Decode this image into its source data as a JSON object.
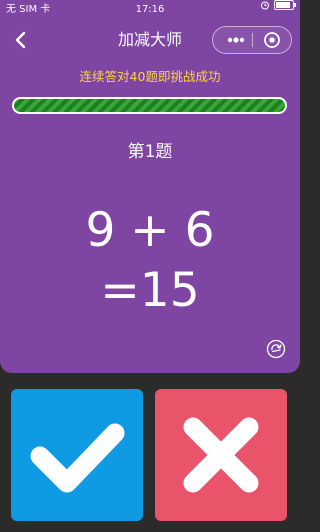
{
  "status": {
    "carrier": "无 SIM 卡",
    "time": "17:16",
    "battery_level": 0.9
  },
  "nav": {
    "title": "加减大师",
    "back_icon": "chevron-left-icon",
    "more_icon": "more-dots-icon",
    "close_icon": "target-icon"
  },
  "game": {
    "challenge_text": "连续答对40题即挑战成功",
    "progress": 1.0,
    "question_label": "第1题",
    "equation": "9 + 6",
    "result": "=15"
  },
  "buttons": {
    "correct_icon": "check-icon",
    "wrong_icon": "cross-icon"
  },
  "colors": {
    "primary": "#7e45a3",
    "accent_text": "#ffd24a",
    "progress": "#35a836",
    "correct": "#0f9be3",
    "wrong": "#e9546a",
    "background": "#2b2b2b"
  }
}
